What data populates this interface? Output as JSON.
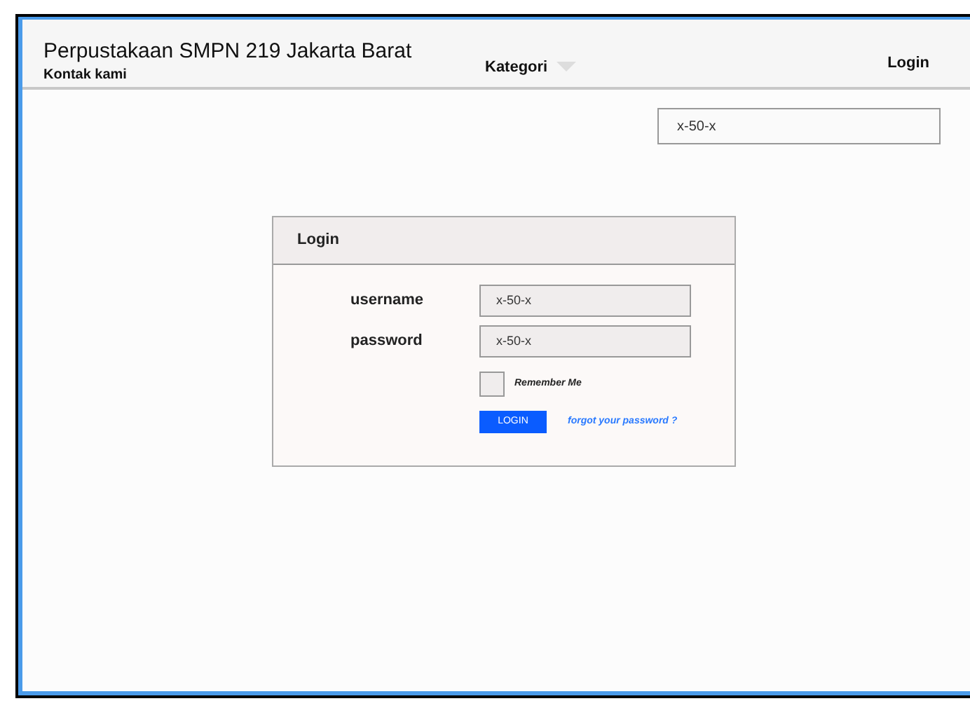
{
  "header": {
    "title": "Perpustakaan SMPN 219 Jakarta Barat",
    "subtitle": "Kontak kami",
    "menu": "Kategori",
    "login": "Login"
  },
  "search": {
    "value": "x-50-x"
  },
  "login_card": {
    "title": "Login",
    "fields": [
      {
        "label": "username",
        "value": "x-50-x"
      },
      {
        "label": "password",
        "value": "x-50-x"
      }
    ],
    "remember": {
      "label": "Remember Me",
      "checked": false
    },
    "button": "LOGIN",
    "forgot": "forgot your password ?"
  }
}
